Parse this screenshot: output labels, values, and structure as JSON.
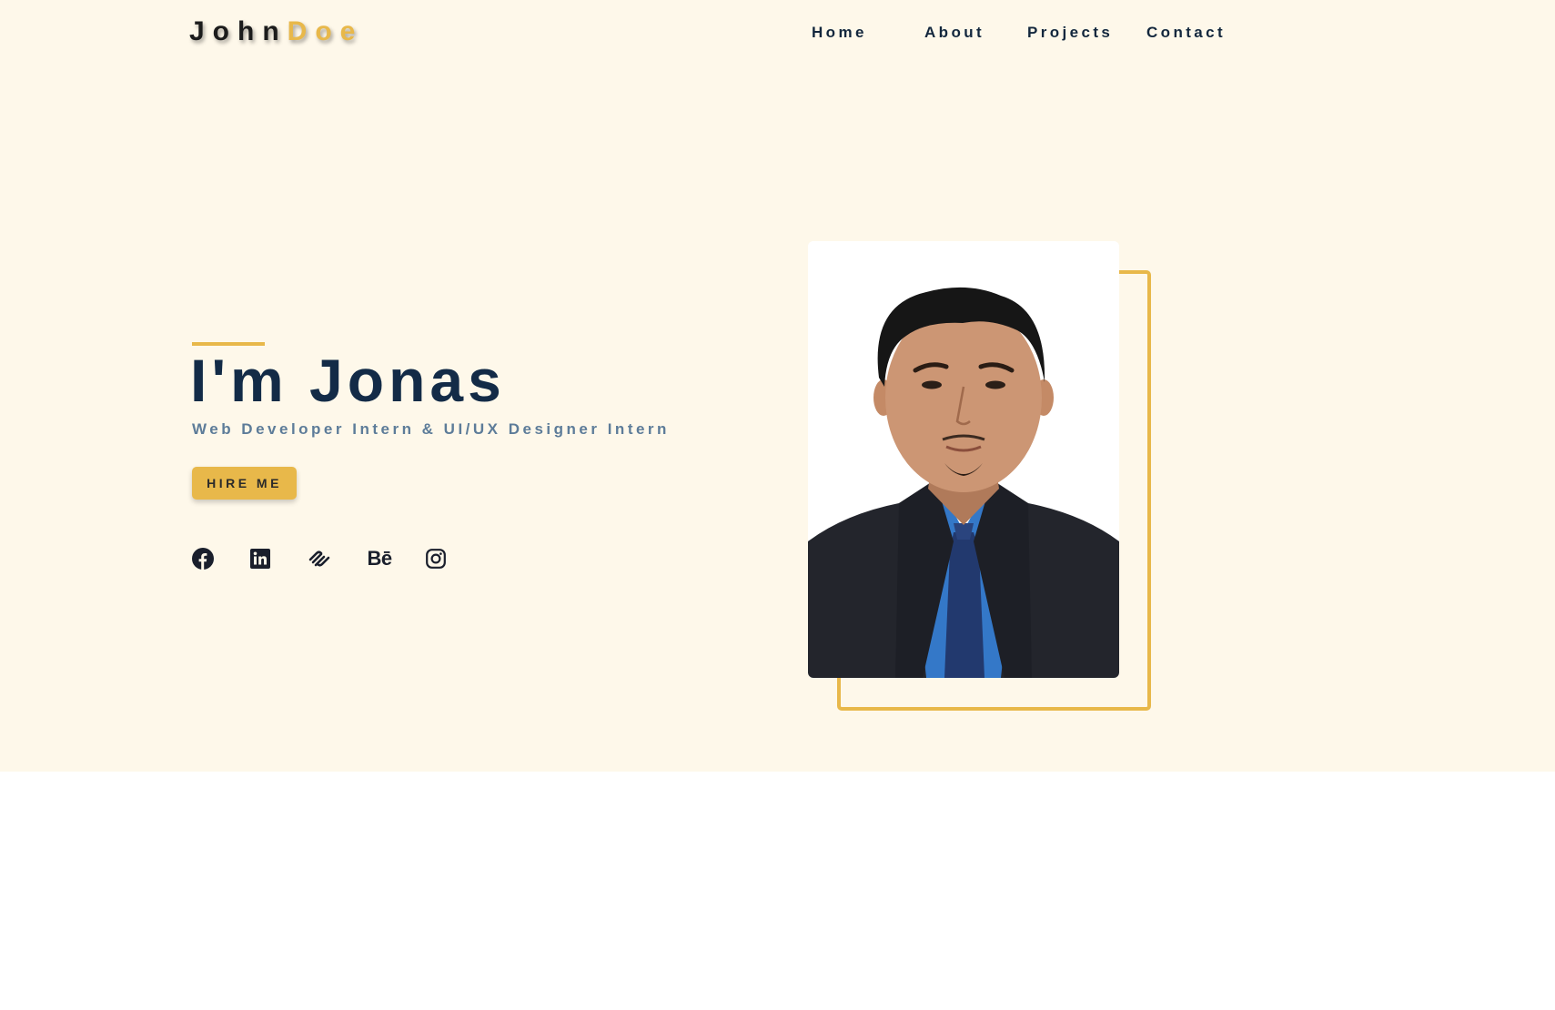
{
  "brand": {
    "first": "John",
    "last": "Doe"
  },
  "nav": {
    "home": "Home",
    "about": "About",
    "projects": "Projects",
    "contact": "Contact"
  },
  "hero": {
    "title": "I'm Jonas",
    "subtitle": "Web Developer Intern & UI/UX Designer Intern",
    "cta": "HIRE ME"
  },
  "social": {
    "facebook": "facebook-icon",
    "linkedin": "linkedin-icon",
    "squarespace": "squarespace-icon",
    "behance": "Bē",
    "instagram": "instagram-icon"
  },
  "colors": {
    "background": "#fef8ea",
    "accent": "#e8b84a",
    "navy": "#132b47",
    "subtitle": "#5d7c99"
  }
}
